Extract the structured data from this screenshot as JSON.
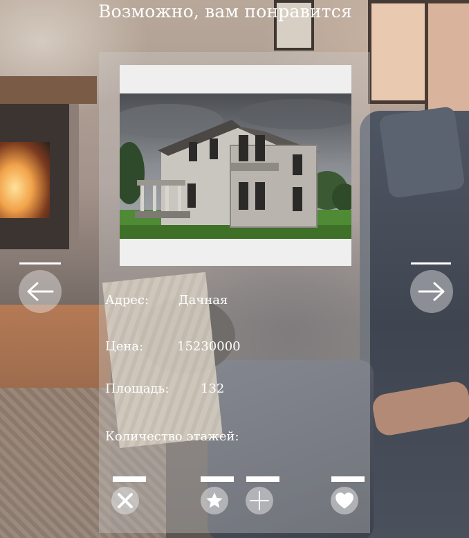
{
  "header": {
    "title": "Возможно, вам понравится"
  },
  "listing": {
    "address_label": "Адрес:",
    "address_value": "Дачная",
    "price_label": "Цена:",
    "price_value": "15230000",
    "area_label": "Площадь:",
    "area_value": "132",
    "floors_label": "Количество этажей:",
    "floors_value": ""
  },
  "icons": {
    "prev": "arrow-left-icon",
    "next": "arrow-right-icon",
    "dislike": "close-icon",
    "favorite": "star-icon",
    "add": "plus-icon",
    "like": "heart-icon"
  },
  "colors": {
    "text": "#ffffff",
    "card": "rgba(205,205,205,0.36)",
    "photo_frame": "#efefef"
  }
}
